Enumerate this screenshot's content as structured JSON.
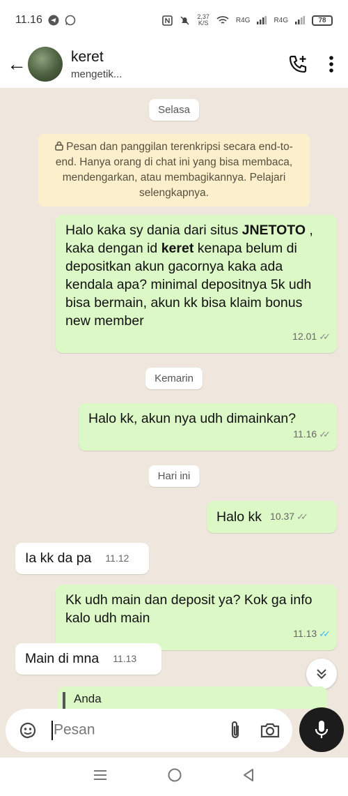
{
  "status_bar": {
    "time": "11.16",
    "net_speed_value": "2,37",
    "net_speed_unit": "K/S",
    "signal1": "R4G",
    "signal2": "R4G",
    "battery": "78"
  },
  "header": {
    "contact_name": "keret",
    "status": "mengetik..."
  },
  "chat": {
    "encryption_notice": "Pesan dan panggilan terenkripsi secara end-to-end. Hanya orang di chat ini yang bisa membaca, mendengarkan, atau membagikannya. Pelajari selengkapnya.",
    "dates": {
      "selasa": "Selasa",
      "kemarin": "Kemarin",
      "hari_ini": "Hari ini"
    },
    "msg1": {
      "part1": "Halo kaka sy dania dari situs ",
      "bold1": "JNETOTO",
      "part2": " , kaka dengan id  ",
      "bold2": "keret",
      "part3": " kenapa belum di depositkan akun gacornya kaka ada kendala apa? minimal depositnya 5k udh bisa bermain, akun kk bisa klaim bonus new member",
      "time": "12.01"
    },
    "msg2": {
      "text": "Halo kk, akun nya udh dimainkan?",
      "time": "11.16"
    },
    "msg3": {
      "text": "Halo kk",
      "time": "10.37"
    },
    "msg4": {
      "text": "Ia kk da pa",
      "time": "11.12"
    },
    "msg5": {
      "text": "Kk udh main dan deposit ya? Kok ga info kalo udh main",
      "time": "11.13"
    },
    "msg6": {
      "text": "Main di mna",
      "time": "11.13"
    },
    "quoted_preview": "Anda"
  },
  "composer": {
    "placeholder": "Pesan"
  },
  "colors": {
    "outgoing": "#dcf8c6",
    "incoming": "#ffffff",
    "wallpaper": "#efe7dd",
    "read_ticks": "#34b7f1",
    "mic_button": "#1c1c1c"
  }
}
